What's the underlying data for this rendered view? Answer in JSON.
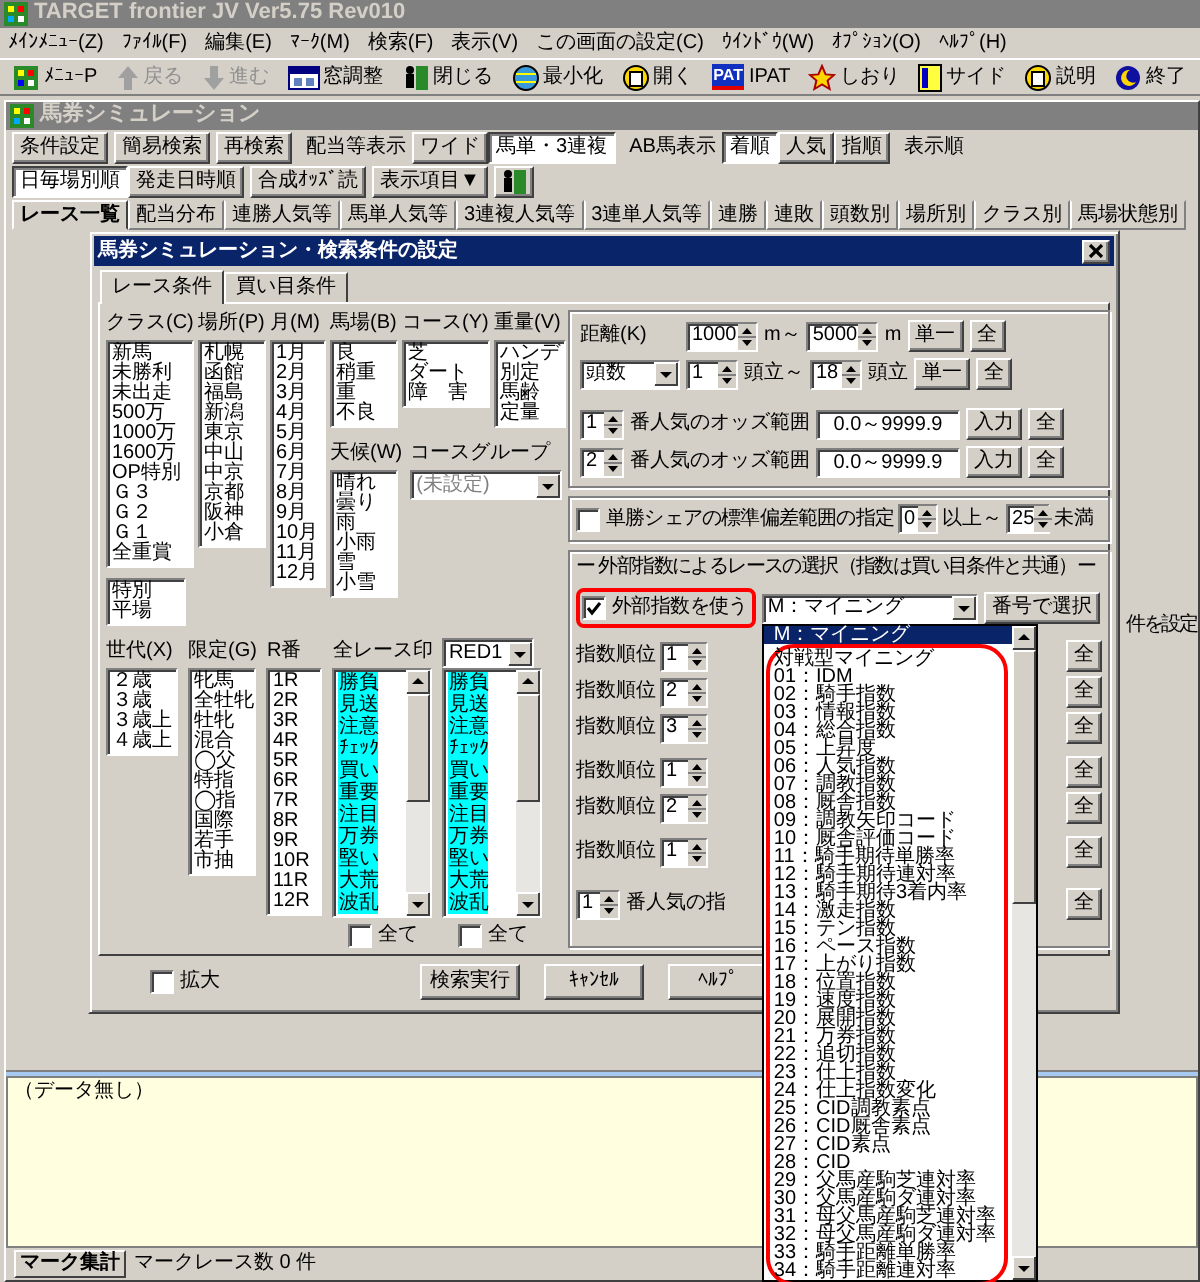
{
  "window": {
    "title": "TARGET frontier JV  Ver5.75  Rev010"
  },
  "menu": [
    "ﾒｲﾝﾒﾆｭｰ(Z)",
    "ﾌｧｲﾙ(F)",
    "編集(E)",
    "ﾏｰｸ(M)",
    "検索(F)",
    "表示(V)",
    "この画面の設定(C)",
    "ｳｲﾝﾄﾞｳ(W)",
    "ｵﾌﾟｼｮﾝ(O)",
    "ﾍﾙﾌﾟ(H)"
  ],
  "toolbar": [
    {
      "label": "ﾒﾆｭｰP",
      "disabled": false
    },
    {
      "label": "戻る",
      "disabled": true
    },
    {
      "label": "進む",
      "disabled": true
    },
    {
      "label": "窓調整",
      "disabled": false
    },
    {
      "label": "閉じる",
      "disabled": false
    },
    {
      "label": "最小化",
      "disabled": false
    },
    {
      "label": "開く",
      "disabled": false
    },
    {
      "badge": "PAT",
      "label": "IPAT",
      "disabled": false
    },
    {
      "label": "しおり",
      "disabled": false
    },
    {
      "label": "サイド",
      "disabled": false
    },
    {
      "label": "説明",
      "disabled": false
    },
    {
      "label": "終了",
      "disabled": false
    }
  ],
  "sim_window": {
    "title": "馬券シミュレーション",
    "controls": [
      {
        "kind": "button",
        "label": "条件設定"
      },
      {
        "kind": "button",
        "label": "簡易検索"
      },
      {
        "kind": "button",
        "label": "再検索"
      },
      {
        "kind": "label",
        "label": "配当等表示"
      },
      {
        "kind": "toggle",
        "options": [
          {
            "label": "ワイド",
            "selected": false
          },
          {
            "label": "馬単・3連複",
            "selected": true
          }
        ]
      },
      {
        "kind": "label",
        "label": "AB馬表示"
      },
      {
        "kind": "toggle",
        "options": [
          {
            "label": "着順",
            "selected": true
          },
          {
            "label": "人気",
            "selected": false
          },
          {
            "label": "指順",
            "selected": false
          }
        ]
      },
      {
        "kind": "label",
        "label": "表示順"
      },
      {
        "kind": "toggle",
        "options": [
          {
            "label": "日毎場別順",
            "selected": true
          },
          {
            "label": "発走日時順",
            "selected": false
          }
        ]
      },
      {
        "kind": "button",
        "label": "合成ｵｯｽﾞ読"
      },
      {
        "kind": "button",
        "label": "表示項目▼"
      },
      {
        "kind": "icon"
      }
    ],
    "tabs": [
      {
        "label": "レース一覧",
        "selected": true
      },
      {
        "label": "配当分布",
        "selected": false
      },
      {
        "label": "連勝人気等",
        "selected": false
      },
      {
        "label": "馬単人気等",
        "selected": false
      },
      {
        "label": "3連複人気等",
        "selected": false
      },
      {
        "label": "3連単人気等",
        "selected": false
      },
      {
        "label": "連勝",
        "selected": false
      },
      {
        "label": "連敗",
        "selected": false
      },
      {
        "label": "頭数別",
        "selected": false
      },
      {
        "label": "場所別",
        "selected": false
      },
      {
        "label": "クラス別",
        "selected": false
      },
      {
        "label": "馬場状態別",
        "selected": false
      }
    ],
    "side_text": "件を設定",
    "log": "（データ無し）",
    "status": {
      "section": "マーク集計",
      "text": "マークレース数 0 件"
    }
  },
  "dialog": {
    "title": "馬券シミュレーション・検索条件の設定",
    "tabs": [
      {
        "label": "レース条件",
        "selected": true
      },
      {
        "label": "買い目条件",
        "selected": false
      }
    ],
    "class_list": {
      "label": "クラス(C)",
      "items": [
        "新馬",
        "未勝利",
        "未出走",
        "500万",
        "1000万",
        "1600万",
        "OP特別",
        "Ｇ３",
        "Ｇ２",
        "Ｇ１",
        "全重賞"
      ]
    },
    "special_list": {
      "items": [
        "特別",
        "平場"
      ]
    },
    "place_list": {
      "label": "場所(P)",
      "items": [
        "札幌",
        "函館",
        "福島",
        "新潟",
        "東京",
        "中山",
        "中京",
        "京都",
        "阪神",
        "小倉"
      ]
    },
    "month_list": {
      "label": "月(M)",
      "items": [
        "1月",
        "2月",
        "3月",
        "4月",
        "5月",
        "6月",
        "7月",
        "8月",
        "9月",
        "10月",
        "11月",
        "12月"
      ]
    },
    "track_list": {
      "label": "馬場(B)",
      "items": [
        "良",
        "稍重",
        "重",
        "不良"
      ]
    },
    "course_list": {
      "label": "コース(Y)",
      "items": [
        "芝",
        "ダート",
        "障　害"
      ]
    },
    "weight_list": {
      "label": "重量(V)",
      "items": [
        "ハンデ",
        "別定",
        "馬齢",
        "定量"
      ]
    },
    "weather_list": {
      "label": "天候(W)",
      "items": [
        "晴れ",
        "曇り",
        "雨",
        "小雨",
        "雪",
        "小雪"
      ]
    },
    "course_group": {
      "label": "コースグループ",
      "value": "(未設定)",
      "disabled": true
    },
    "age_list": {
      "label": "世代(X)",
      "items": [
        "２歳",
        "３歳",
        "３歳上",
        "４歳上"
      ]
    },
    "limit_list": {
      "label": "限定(G)",
      "items": [
        "牝馬",
        "全牡牝",
        "牡牝",
        "混合",
        "◯父",
        "特指",
        "◯指",
        "国際",
        "若手",
        "市抽"
      ]
    },
    "race_no_list": {
      "label": "R番",
      "items": [
        "1R",
        "2R",
        "3R",
        "4R",
        "5R",
        "6R",
        "7R",
        "8R",
        "9R",
        "10R",
        "11R",
        "12R"
      ]
    },
    "mark_lists": [
      {
        "label": "全レース印",
        "items": [
          {
            "text": "勝負",
            "selected": true
          },
          {
            "text": "見送",
            "selected": true
          },
          {
            "text": "注意",
            "selected": true
          },
          {
            "text": "ﾁｪｯｸ",
            "selected": true
          },
          {
            "text": "買い",
            "selected": true
          },
          {
            "text": "重要",
            "selected": true
          },
          {
            "text": "注目",
            "selected": true
          },
          {
            "text": "万券",
            "selected": true
          },
          {
            "text": "堅い",
            "selected": true
          },
          {
            "text": "大荒",
            "selected": true
          },
          {
            "text": "波乱",
            "selected": true
          }
        ],
        "all_label": "全て",
        "all_checked": false
      },
      {
        "combo": "RED1",
        "items": [
          {
            "text": "勝負",
            "selected": true
          },
          {
            "text": "見送",
            "selected": true
          },
          {
            "text": "注意",
            "selected": true
          },
          {
            "text": "ﾁｪｯｸ",
            "selected": true
          },
          {
            "text": "買い",
            "selected": true
          },
          {
            "text": "重要",
            "selected": true
          },
          {
            "text": "注目",
            "selected": true
          },
          {
            "text": "万券",
            "selected": true
          },
          {
            "text": "堅い",
            "selected": true
          },
          {
            "text": "大荒",
            "selected": true
          },
          {
            "text": "波乱",
            "selected": true
          }
        ],
        "all_label": "全て",
        "all_checked": false
      }
    ],
    "distance": {
      "label": "距離(K)",
      "from": "1000",
      "unit1": "m～",
      "to": "5000",
      "unit2": "m",
      "single": "単一",
      "all": "全"
    },
    "heads": {
      "combo": "頭数",
      "from": "1",
      "unit1": "頭立～",
      "to": "18",
      "unit2": "頭立",
      "single": "単一",
      "all": "全"
    },
    "odds_rows": [
      {
        "rank": "1",
        "label": "番人気のオッズ範囲",
        "range": "0.0～9999.9",
        "input": "入力",
        "all": "全"
      },
      {
        "rank": "2",
        "label": "番人気のオッズ範囲",
        "range": "0.0～9999.9",
        "input": "入力",
        "all": "全"
      }
    ],
    "share": {
      "checked": false,
      "label": "単勝シェアの標準偏差範囲の指定",
      "from": "0",
      "mid": "以上～",
      "to": "25",
      "end": "未満"
    },
    "external": {
      "legend": "ー 外部指数によるレースの選択（指数は買い目条件と共通）ー",
      "use_label": "外部指数を使う",
      "use_checked": true,
      "index": "M：マイニング",
      "pick_button": "番号で選択",
      "groups": [
        [
          {
            "label": "指数順位",
            "value": "1",
            "all": "全"
          },
          {
            "label": "指数順位",
            "value": "2",
            "all": "全"
          },
          {
            "label": "指数順位",
            "value": "3",
            "all": "全"
          }
        ],
        [
          {
            "label": "指数順位",
            "value": "1",
            "all": "全"
          },
          {
            "label": "指数順位",
            "value": "2",
            "all": "全"
          }
        ],
        [
          {
            "label": "指数順位",
            "value": "1",
            "all": "全"
          }
        ]
      ],
      "popularity_row": {
        "value": "1",
        "label": "番人気の指",
        "all": "全"
      }
    },
    "index_options": [
      {
        "text": "M：マイニング",
        "selected": true
      },
      {
        "text": "対戦型マイニング",
        "selected": false
      },
      {
        "text": "01：IDM",
        "selected": false
      },
      {
        "text": "02：騎手指数",
        "selected": false
      },
      {
        "text": "03：情報指数",
        "selected": false
      },
      {
        "text": "04：総合指数",
        "selected": false
      },
      {
        "text": "05：上昇度",
        "selected": false
      },
      {
        "text": "06：人気指数",
        "selected": false
      },
      {
        "text": "07：調教指数",
        "selected": false
      },
      {
        "text": "08：厩舎指数",
        "selected": false
      },
      {
        "text": "09：調教矢印コード",
        "selected": false
      },
      {
        "text": "10：厩舎評価コード",
        "selected": false
      },
      {
        "text": "11：騎手期待単勝率",
        "selected": false
      },
      {
        "text": "12：騎手期待連対率",
        "selected": false
      },
      {
        "text": "13：騎手期待3着内率",
        "selected": false
      },
      {
        "text": "14：激走指数",
        "selected": false
      },
      {
        "text": "15：テン指数",
        "selected": false
      },
      {
        "text": "16：ペース指数",
        "selected": false
      },
      {
        "text": "17：上がり指数",
        "selected": false
      },
      {
        "text": "18：位置指数",
        "selected": false
      },
      {
        "text": "19：速度指数",
        "selected": false
      },
      {
        "text": "20：展開指数",
        "selected": false
      },
      {
        "text": "21：万券指数",
        "selected": false
      },
      {
        "text": "22：追切指数",
        "selected": false
      },
      {
        "text": "23：仕上指数",
        "selected": false
      },
      {
        "text": "24：仕上指数変化",
        "selected": false
      },
      {
        "text": "25：CID調教素点",
        "selected": false
      },
      {
        "text": "26：CID厩舎素点",
        "selected": false
      },
      {
        "text": "27：CID素点",
        "selected": false
      },
      {
        "text": "28：CID",
        "selected": false
      },
      {
        "text": "29：父馬産駒芝連対率",
        "selected": false
      },
      {
        "text": "30：父馬産駒ダ連対率",
        "selected": false
      },
      {
        "text": "31：母父馬産駒芝連対率",
        "selected": false
      },
      {
        "text": "32：母父馬産駒ダ連対率",
        "selected": false
      },
      {
        "text": "33：騎手距離単勝率",
        "selected": false
      },
      {
        "text": "34：騎手距離連対率",
        "selected": false
      }
    ],
    "enlarge": {
      "label": "拡大",
      "checked": false
    },
    "buttons": [
      "検索実行",
      "ｷｬﾝｾﾙ",
      "ﾍﾙﾌﾟ"
    ]
  }
}
